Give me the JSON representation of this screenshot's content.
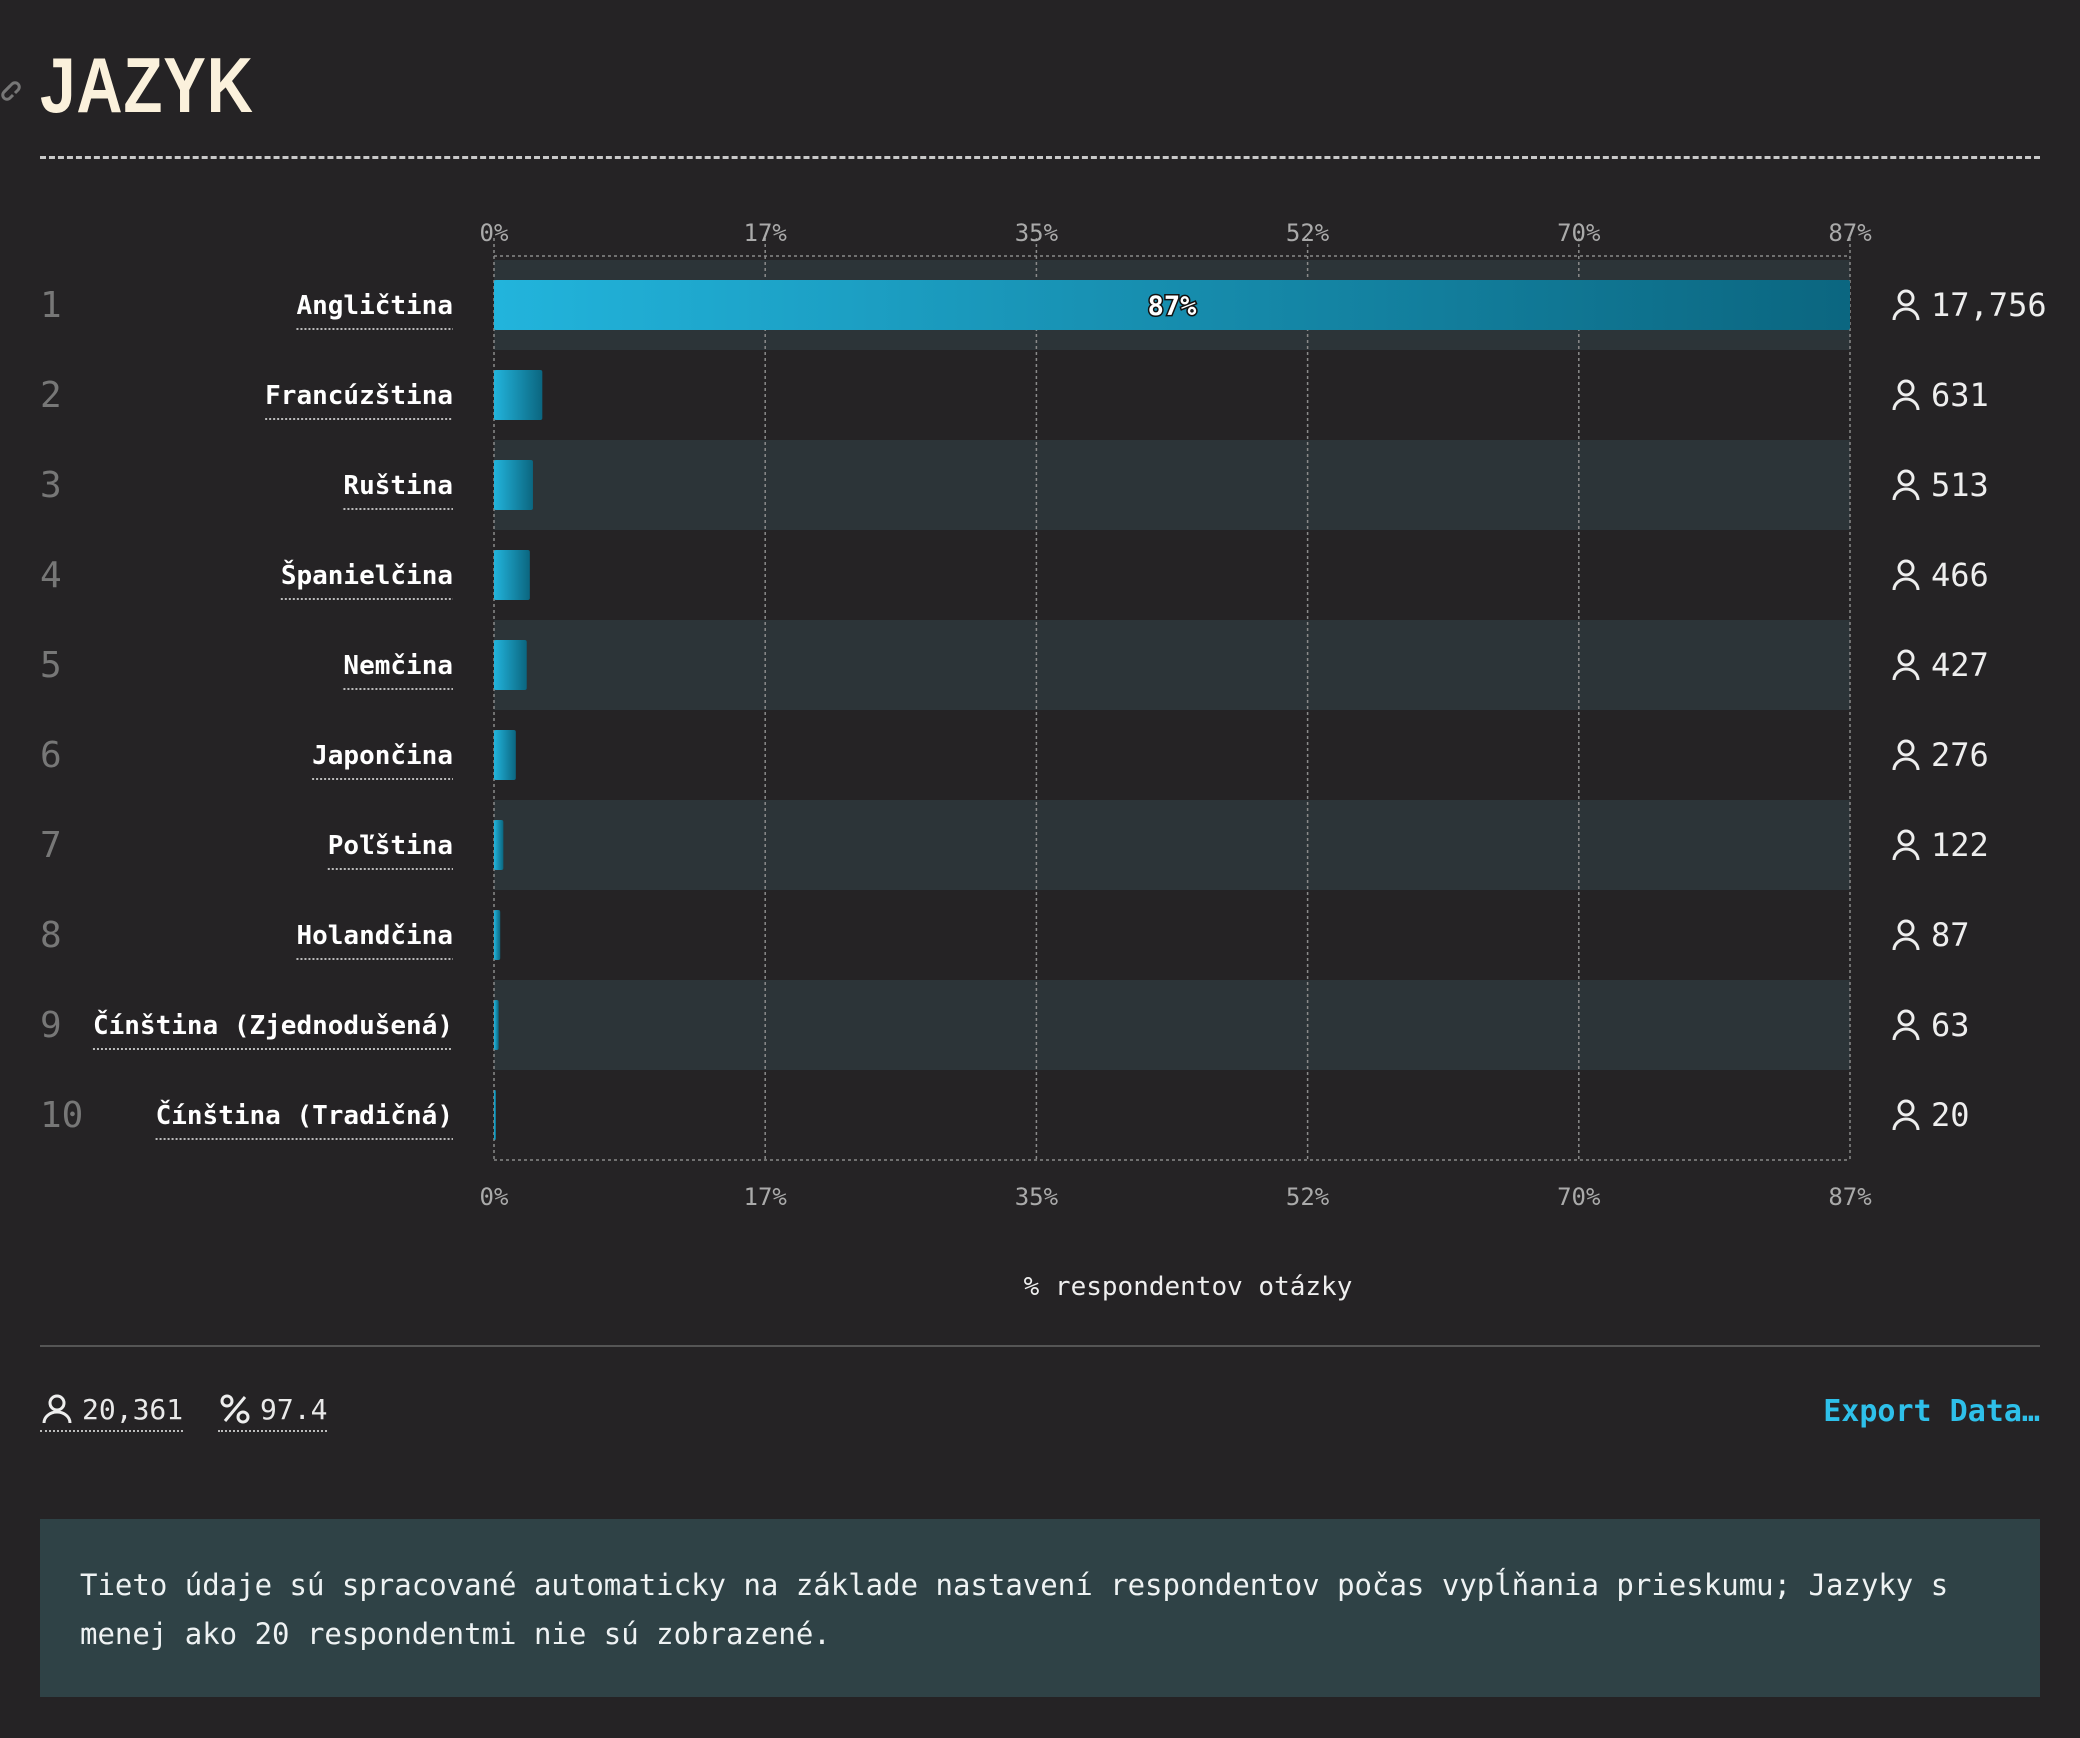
{
  "header": {
    "title": "JAZYK"
  },
  "chart_data": {
    "type": "bar",
    "orientation": "horizontal",
    "xlabel": "% respondentov otázky",
    "xlim": [
      0,
      87
    ],
    "ticks": [
      "0%",
      "17%",
      "35%",
      "52%",
      "70%",
      "87%"
    ],
    "bars": [
      {
        "rank": "1",
        "label": "Angličtina",
        "count": "17,756",
        "value": 87,
        "data_label": "87%"
      },
      {
        "rank": "2",
        "label": "Francúzština",
        "count": "631",
        "value": 3.1
      },
      {
        "rank": "3",
        "label": "Ruština",
        "count": "513",
        "value": 2.5
      },
      {
        "rank": "4",
        "label": "Španielčina",
        "count": "466",
        "value": 2.3
      },
      {
        "rank": "5",
        "label": "Nemčina",
        "count": "427",
        "value": 2.1
      },
      {
        "rank": "6",
        "label": "Japončina",
        "count": "276",
        "value": 1.4
      },
      {
        "rank": "7",
        "label": "Poľština",
        "count": "122",
        "value": 0.6
      },
      {
        "rank": "8",
        "label": "Holandčina",
        "count": "87",
        "value": 0.4
      },
      {
        "rank": "9",
        "label": "Čínština (Zjednodušená)",
        "count": "63",
        "value": 0.3
      },
      {
        "rank": "10",
        "label": "Čínština (Tradičná)",
        "count": "20",
        "value": 0.1
      }
    ],
    "colors": {
      "bar_start": "#22b4dc",
      "bar_end": "#0b6680",
      "band": "#2c3438"
    }
  },
  "stats": {
    "respondents": "20,361",
    "percent": "97.4"
  },
  "export_label": "Export Data…",
  "note": "Tieto údaje sú spracované automaticky na základe nastavení respondentov počas vypĺňania prieskumu; Jazyky s menej ako 20 respondentmi nie sú zobrazené.",
  "icons": {
    "user": "user-icon",
    "percent": "percent-icon",
    "link": "link-icon"
  }
}
